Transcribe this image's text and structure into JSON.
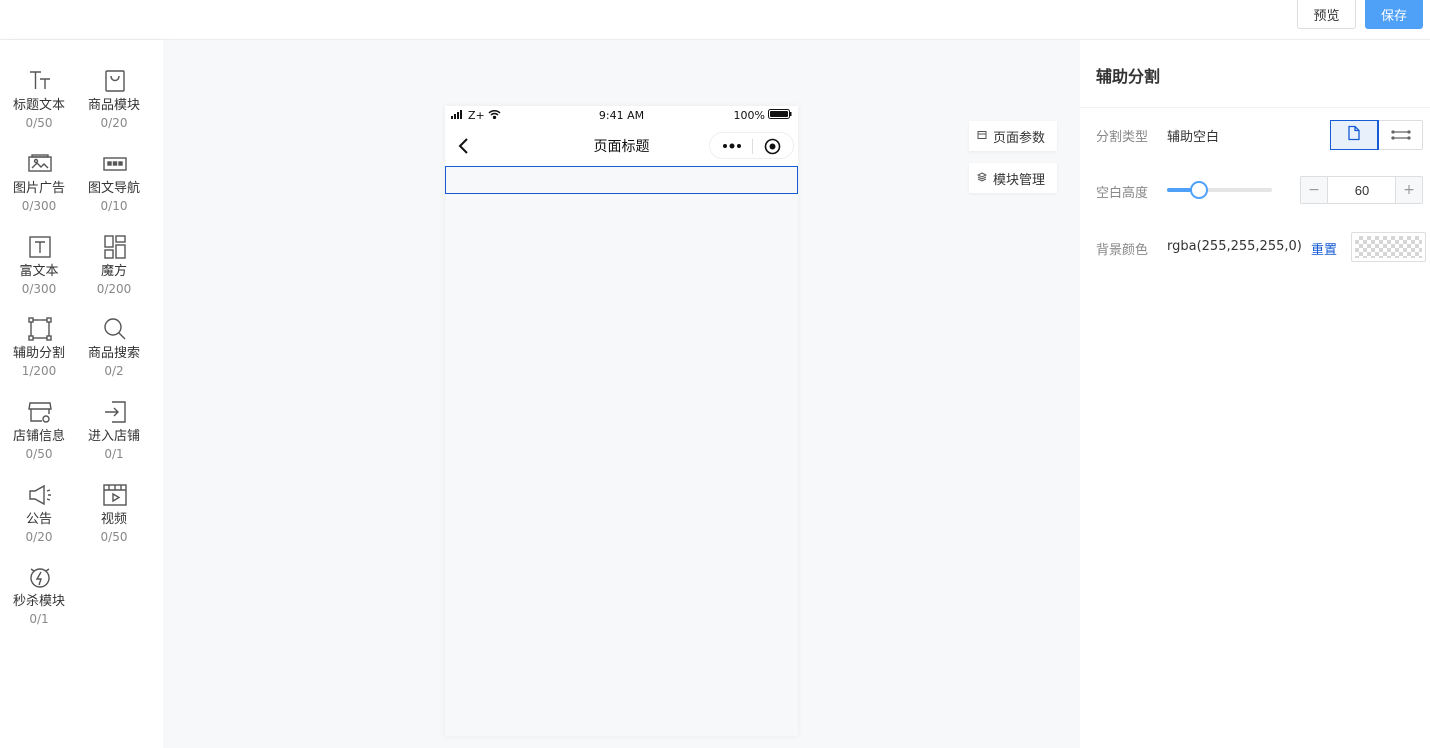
{
  "topbar": {
    "preview_label": "预览",
    "save_label": "保存"
  },
  "palette": [
    {
      "label": "标题文本",
      "count": "0/50",
      "icon": "title-text-icon"
    },
    {
      "label": "商品模块",
      "count": "0/20",
      "icon": "shopping-bag-icon"
    },
    {
      "label": "图片广告",
      "count": "0/300",
      "icon": "image-ad-icon"
    },
    {
      "label": "图文导航",
      "count": "0/10",
      "icon": "image-nav-icon"
    },
    {
      "label": "富文本",
      "count": "0/300",
      "icon": "rich-text-icon"
    },
    {
      "label": "魔方",
      "count": "0/200",
      "icon": "cube-grid-icon"
    },
    {
      "label": "辅助分割",
      "count": "1/200",
      "icon": "divider-frame-icon"
    },
    {
      "label": "商品搜索",
      "count": "0/2",
      "icon": "search-icon"
    },
    {
      "label": "店铺信息",
      "count": "0/50",
      "icon": "store-icon"
    },
    {
      "label": "进入店铺",
      "count": "0/1",
      "icon": "enter-store-icon"
    },
    {
      "label": "公告",
      "count": "0/20",
      "icon": "megaphone-icon"
    },
    {
      "label": "视频",
      "count": "0/50",
      "icon": "video-icon"
    },
    {
      "label": "秒杀模块",
      "count": "0/1",
      "icon": "flash-sale-icon"
    }
  ],
  "phone": {
    "carrier": "Z+",
    "time": "9:41 AM",
    "battery": "100%",
    "page_title": "页面标题"
  },
  "side_buttons": {
    "page_params": "页面参数",
    "module_manage": "模块管理"
  },
  "panel": {
    "title": "辅助分割",
    "split_type_label": "分割类型",
    "split_type_value": "辅助空白",
    "height_label": "空白高度",
    "height_value": "60",
    "height_fraction": 0.3,
    "bg_label": "背景颜色",
    "bg_value": "rgba(255,255,255,0)",
    "reset_label": "重置"
  },
  "colors": {
    "accent": "#155bd4",
    "save_button": "#4fa0f7"
  }
}
